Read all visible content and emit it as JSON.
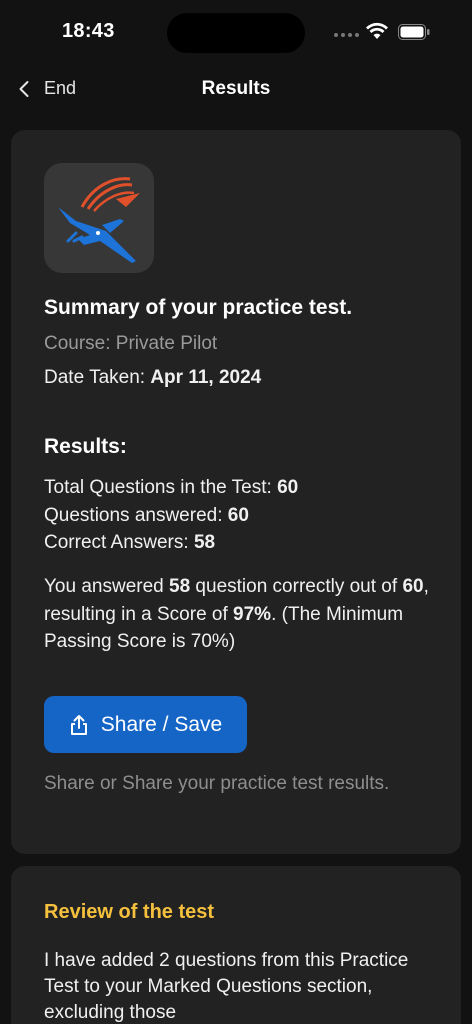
{
  "status_bar": {
    "time": "18:43"
  },
  "nav": {
    "back_label": "End",
    "title": "Results"
  },
  "summary": {
    "title": "Summary of your practice test.",
    "course_line": "Course: Private Pilot",
    "date_label": "Date Taken: ",
    "date_value": "Apr 11, 2024"
  },
  "results": {
    "heading": "Results:",
    "total_label": "Total Questions in the Test: ",
    "total_value": "60",
    "answered_label": "Questions answered: ",
    "answered_value": "60",
    "correct_label": "Correct Answers: ",
    "correct_value": "58",
    "p1": "You answered ",
    "p2": "58",
    "p3": " question correctly out of ",
    "p4": "60",
    "p5": ", resulting in a Score of ",
    "p6": "97%",
    "p7": ". (The Minimum Passing Score is 70%)"
  },
  "share": {
    "button_label": "Share / Save",
    "note": "Share or Share your practice test results."
  },
  "review": {
    "heading": "Review of the test",
    "text": "I have added 2 questions from this Practice Test to your Marked Questions section, excluding those"
  },
  "colors": {
    "background": "#121212",
    "card": "#222222",
    "accent_blue": "#1565c6",
    "review_heading": "#f4c03d",
    "muted_text": "#9a9a9a"
  },
  "icons": {
    "back": "chevron-left-icon",
    "share": "share-icon",
    "wifi": "wifi-icon",
    "battery": "battery-icon",
    "logo": "airplane-logo"
  }
}
